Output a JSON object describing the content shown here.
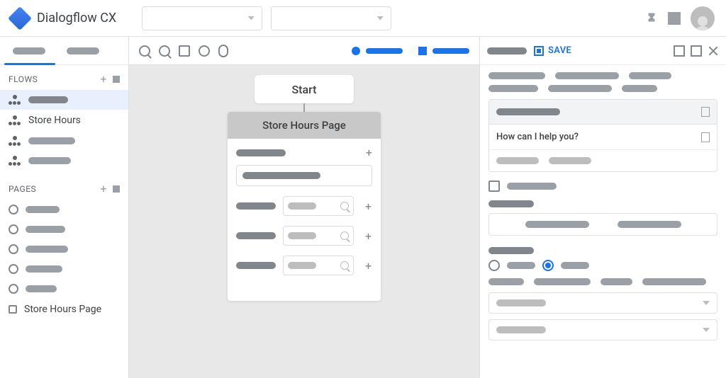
{
  "product": "Dialogflow CX",
  "accent": "#1a73e8",
  "sidebar": {
    "sections": {
      "flows": {
        "title": "FLOWS",
        "items": [
          {
            "label": ""
          },
          {
            "label": "Store Hours"
          },
          {
            "label": ""
          },
          {
            "label": ""
          }
        ]
      },
      "pages": {
        "title": "PAGES",
        "items": [
          {
            "label": ""
          },
          {
            "label": ""
          },
          {
            "label": ""
          },
          {
            "label": ""
          },
          {
            "label": ""
          },
          {
            "label": "Store Hours Page"
          }
        ]
      }
    }
  },
  "canvas": {
    "start_label": "Start",
    "page_title": "Store Hours Page"
  },
  "right_panel": {
    "save_label": "SAVE",
    "agent_says": "How can I help you?"
  }
}
